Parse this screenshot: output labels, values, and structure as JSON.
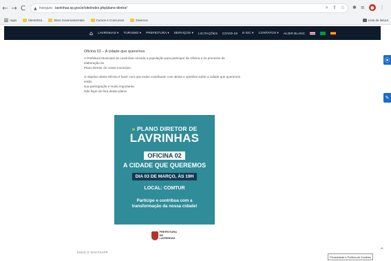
{
  "browser": {
    "back": "←",
    "forward": "→",
    "reload": "C",
    "warning_icon": "▲",
    "security_label": "Inseguro",
    "url": "lavrinhas.sp.gov.br/site/index.php/plano-diretor/",
    "right_label": "Lista de leitura"
  },
  "bookmarks": [
    {
      "label": "Apps",
      "type": "apps"
    },
    {
      "label": "Ident2015",
      "type": "folder"
    },
    {
      "label": "Sites Governamentais",
      "type": "folder"
    },
    {
      "label": "Cursos e Concursos",
      "type": "folder"
    },
    {
      "label": "Diversos",
      "type": "folder"
    }
  ],
  "nav": {
    "items": [
      "LAVRINHAS ▾",
      "TURISMO ▾",
      "PREFEITURA ▾",
      "SERVIÇOS ▾",
      "LICITAÇÕES",
      "COVID-19",
      "E-SIC ▾",
      "CONTATOS ▾",
      "ALDIR BLANC"
    ]
  },
  "content": {
    "heading": "Oficina 02 – A cidade que queremos",
    "para1": [
      "A Prefeitura Municipal de Lavrinhas convida a população para participar da Oficina 2 do processo de",
      "elaboração do",
      "Plano Diretor do nosso município."
    ],
    "para2": [
      "O objetivo desta Oficina é fazer com que todos contribuam com ideias e opiniões sobre a cidade que queremos",
      "então",
      "sua participação é muito importante.",
      "Não fique de fora desse plano!"
    ]
  },
  "poster": {
    "chevrons": "»",
    "title_line1": "PLANO DIRETOR DE",
    "title_line2": "LAVRINHAS",
    "oficina": "OFICINA 02",
    "subtitle": "A CIDADE QUE QUEREMOS",
    "date": "DIA 03 DE MARÇO, ÀS 19H",
    "local": "LOCAL: COMTUR",
    "cta_line1": "Participe e contribua com a",
    "cta_line2": "transformação da nossa cidade!",
    "logo_text_line1": "PREFEITURA DE",
    "logo_text_line2": "LAVRINHAS"
  },
  "footer": {
    "partial_text": "EMAIL E WHATSAPP",
    "privacy_label": "Privacidade e Política de Cookies"
  },
  "colors": {
    "poster_bg": "#2f8c98",
    "poster_dark": "#143a52",
    "nav_bg": "#0d1b2a",
    "side_widget": "#1a6cc8"
  }
}
